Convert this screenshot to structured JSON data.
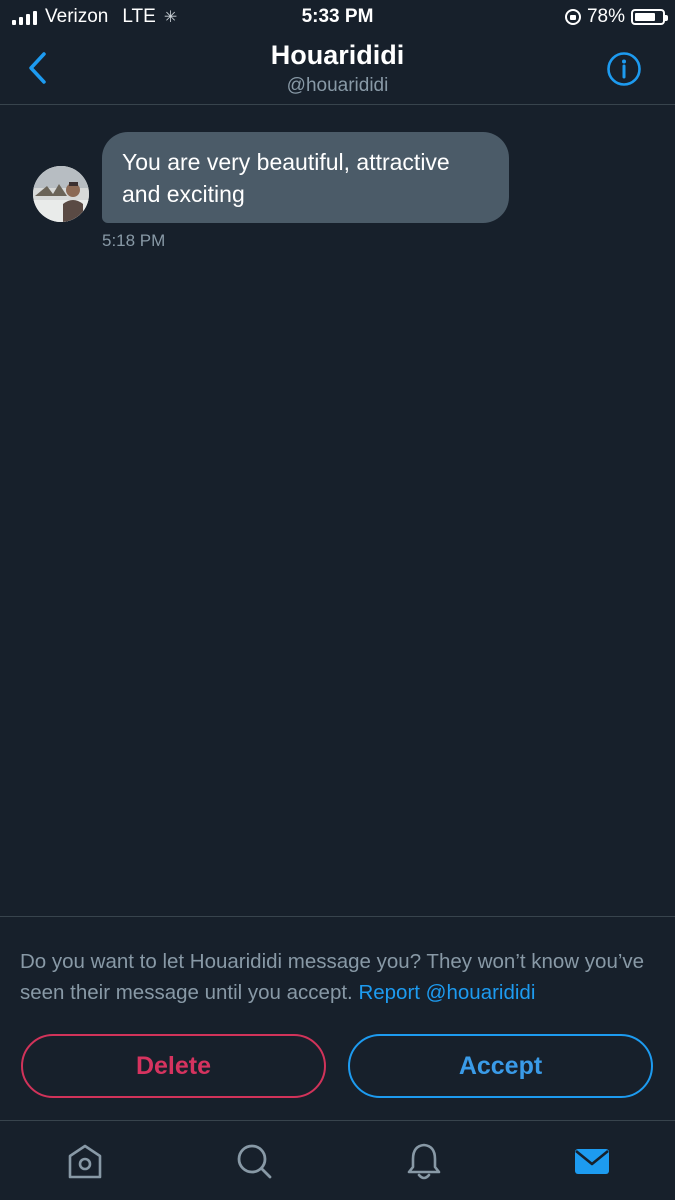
{
  "status_bar": {
    "carrier": "Verizon",
    "network": "LTE",
    "time": "5:33 PM",
    "battery_pct": "78%",
    "battery_level": 0.78
  },
  "header": {
    "title": "Houarididi",
    "handle": "@houarididi"
  },
  "conversation": {
    "messages": [
      {
        "text": "You are very beautiful, attractive and exciting",
        "time": "5:18 PM"
      }
    ]
  },
  "request": {
    "prompt": "Do you want to let Houarididi message you? They won’t know you’ve seen their message until you accept. ",
    "report_link": "Report @houarididi",
    "delete_label": "Delete",
    "accept_label": "Accept"
  },
  "tab_bar": {
    "tabs": [
      {
        "icon": "home-icon"
      },
      {
        "icon": "search-icon"
      },
      {
        "icon": "bell-icon"
      },
      {
        "icon": "mail-icon",
        "active": true
      }
    ]
  },
  "colors": {
    "background": "#17202b",
    "accent": "#1d9bf0",
    "danger": "#d6335f",
    "bubble": "#4b5b68",
    "muted": "#8899a6"
  }
}
